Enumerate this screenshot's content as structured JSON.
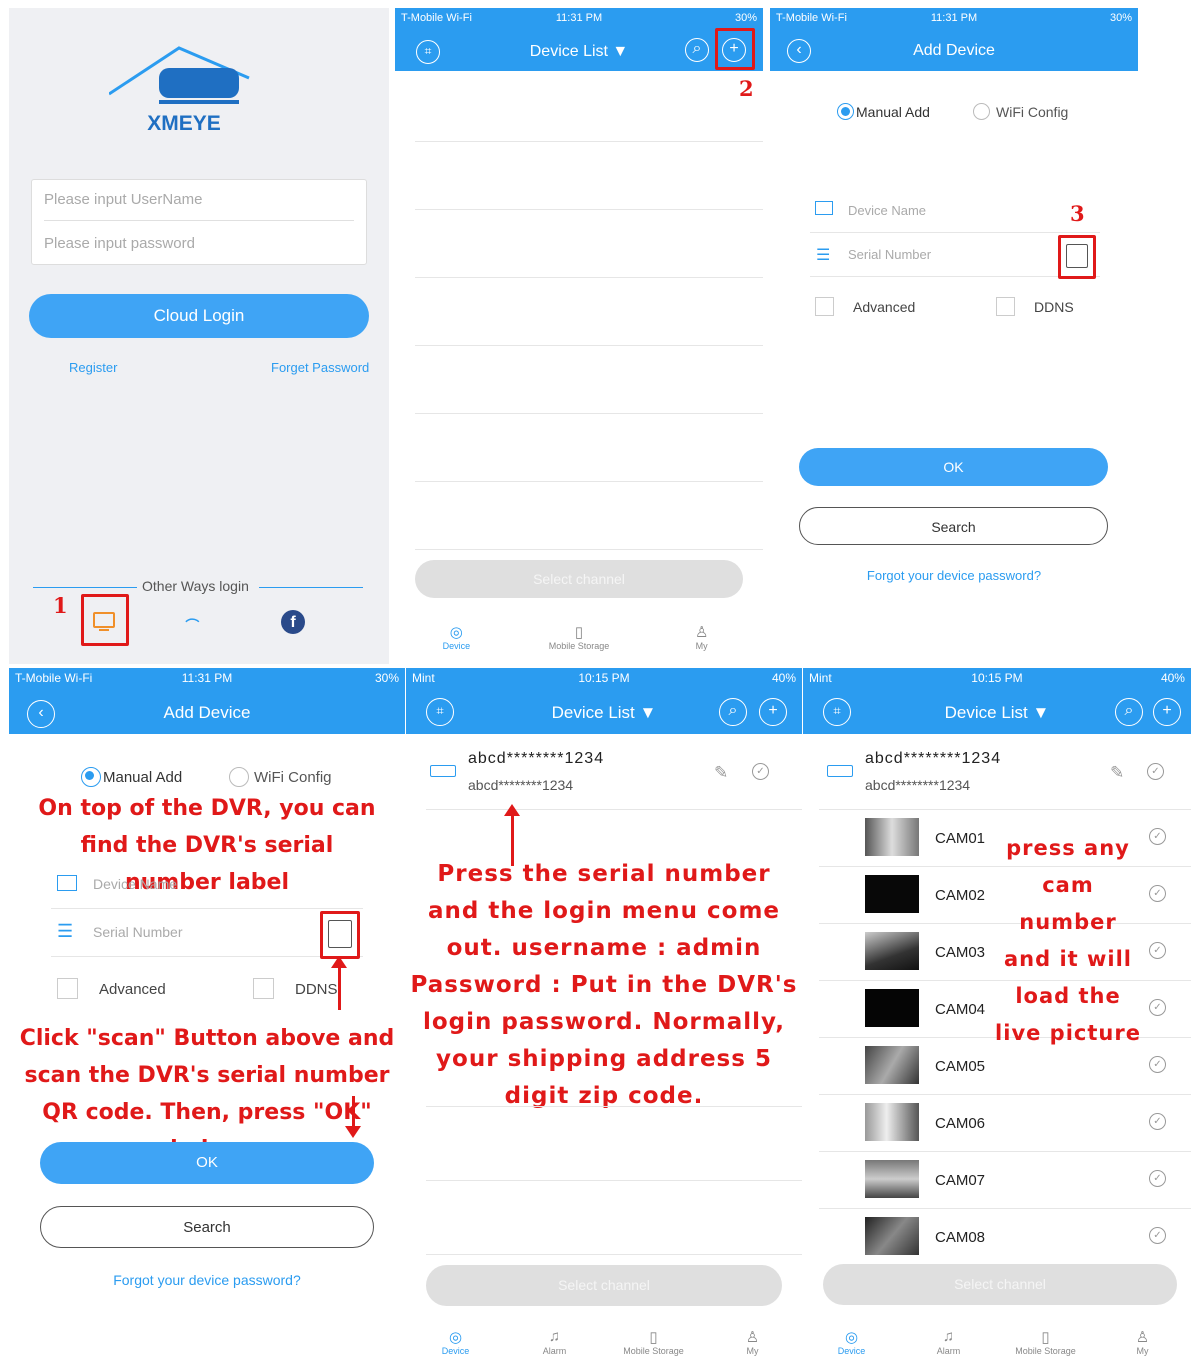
{
  "p1": {
    "brand": "XMEYE",
    "user_ph": "Please input UserName",
    "pass_ph": "Please input password",
    "cloud": "Cloud Login",
    "register": "Register",
    "forget": "Forget Password",
    "other": "Other Ways login",
    "step": "1"
  },
  "p2": {
    "carrier": "T-Mobile Wi-Fi",
    "time": "11:31 PM",
    "batt": "30%",
    "title": "Device List ▼",
    "step": "2",
    "select": "Select channel"
  },
  "p3": {
    "carrier": "T-Mobile Wi-Fi",
    "time": "11:31 PM",
    "batt": "30%",
    "title": "Add Device",
    "manual": "Manual Add",
    "wifi": "WiFi Config",
    "dev_name": "Device Name",
    "serial": "Serial Number",
    "step": "3",
    "advanced": "Advanced",
    "ddns": "DDNS",
    "ok": "OK",
    "search": "Search",
    "forgot": "Forgot your device password?"
  },
  "tabs": {
    "device": "Device",
    "alarm": "Alarm",
    "mobile": "Mobile Storage",
    "my": "My"
  },
  "p4": {
    "carrier": "T-Mobile Wi-Fi",
    "time": "11:31 PM",
    "batt": "30%",
    "title": "Add Device",
    "manual": "Manual Add",
    "wifi": "WiFi Config",
    "note1": "On top of the DVR, you can find the DVR's serial number label",
    "dev_name": "Device Name",
    "serial": "Serial Number",
    "advanced": "Advanced",
    "ddns": "DDNS",
    "note2": "Click \"scan\" Button above and scan the DVR's serial number QR code. Then, press \"OK\" below",
    "ok": "OK",
    "search": "Search",
    "forgot": "Forgot your device password?"
  },
  "p5": {
    "carrier": "Mint",
    "time": "10:15 PM",
    "batt": "40%",
    "title": "Device List ▼",
    "dev": "abcd********1234",
    "dev_sub": "abcd********1234",
    "note": "Press the serial number and the login menu come out. username : admin Password : Put in the DVR's login password. Normally, your shipping address 5 digit zip code.",
    "select": "Select channel"
  },
  "p6": {
    "carrier": "Mint",
    "time": "10:15 PM",
    "batt": "40%",
    "title": "Device List ▼",
    "dev": "abcd********1234",
    "dev_sub": "abcd********1234",
    "cams": [
      "CAM01",
      "CAM02",
      "CAM03",
      "CAM04",
      "CAM05",
      "CAM06",
      "CAM07",
      "CAM08"
    ],
    "note": "press any cam number and it will load the live picture",
    "select": "Select channel"
  },
  "colors": {
    "accent": "#2b9cf0",
    "annotation": "#e01919"
  }
}
